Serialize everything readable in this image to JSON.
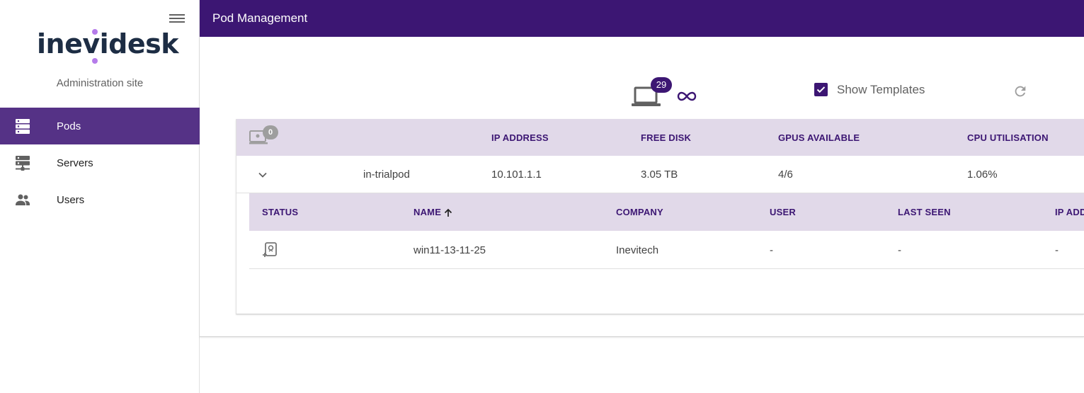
{
  "sidebar": {
    "logo_text": "inevidesk",
    "subtitle": "Administration site",
    "items": [
      {
        "label": "Pods",
        "icon": "server-stack-icon",
        "active": true
      },
      {
        "label": "Servers",
        "icon": "server-network-icon",
        "active": false
      },
      {
        "label": "Users",
        "icon": "users-icon",
        "active": false
      }
    ]
  },
  "header": {
    "title": "Pod Management"
  },
  "toolbar": {
    "pod_count": "29",
    "show_templates_label": "Show Templates",
    "show_templates_checked": true
  },
  "pods_table": {
    "head_badge": "0",
    "columns": [
      "IP ADDRESS",
      "FREE DISK",
      "GPUS AVAILABLE",
      "CPU UTILISATION"
    ],
    "row": {
      "name": "in-trialpod",
      "ip": "10.101.1.1",
      "free_disk": "3.05 TB",
      "gpus": "4/6",
      "cpu": "1.06%"
    }
  },
  "vm_table": {
    "columns": [
      "STATUS",
      "NAME",
      "COMPANY",
      "USER",
      "LAST SEEN",
      "IP ADD"
    ],
    "rows": [
      {
        "name": "win11-13-11-25",
        "company": "Inevitech",
        "user": "-",
        "last_seen": "-",
        "ip": "-"
      }
    ]
  },
  "colors": {
    "primary": "#3c1673",
    "active_nav": "#553286",
    "table_header": "#e1d9e9",
    "logo_dot": "#b57bea"
  }
}
